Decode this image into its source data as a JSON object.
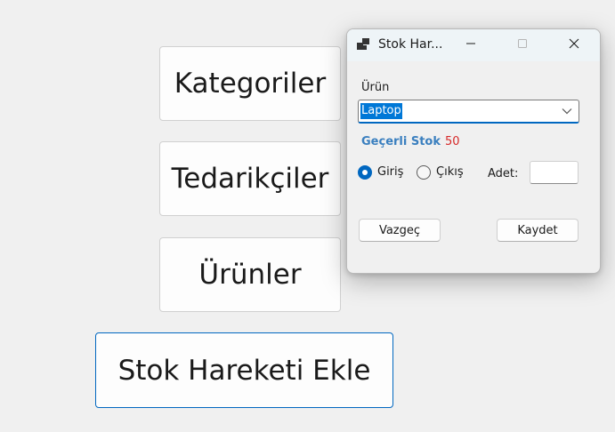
{
  "main_form": {
    "buttons": {
      "kategoriler": "Kategoriler",
      "tedarikciler": "Tedarikçiler",
      "urunler": "Ürünler",
      "stok_hareketi_ekle": "Stok Hareketi Ekle"
    }
  },
  "dialog": {
    "title": "Stok Har...",
    "icon": "app-window-icon",
    "titlebar_buttons": [
      "minimize-icon",
      "maximize-icon",
      "close-icon"
    ],
    "urun_label": "Ürün",
    "urun_selected": "Laptop",
    "gecerli_stok_label": "Geçerli Stok",
    "gecerli_stok_value": "50",
    "hareket_tipi": {
      "giris_label": "Giriş",
      "cikis_label": "Çıkış",
      "selected": "Giriş"
    },
    "adet_label": "Adet:",
    "adet_value": "",
    "vazgec_label": "Vazgeç",
    "kaydet_label": "Kaydet"
  },
  "colors": {
    "accent": "#0067c0",
    "selection": "#0078d7",
    "gecerli_stok_label": "#3a7fbf",
    "stok_value": "#d62828"
  }
}
